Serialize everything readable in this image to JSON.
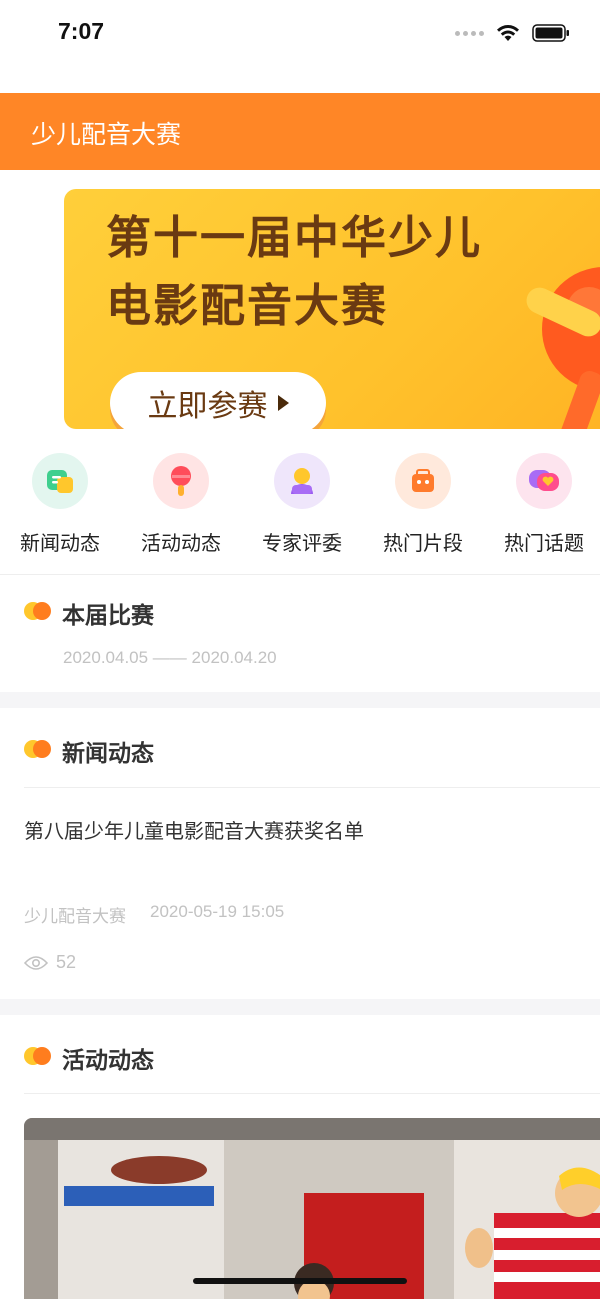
{
  "status": {
    "time": "7:07"
  },
  "header": {
    "title": "少儿配音大赛"
  },
  "banner": {
    "line1": "第十一届中华少儿",
    "line2": "电影配音大赛",
    "button_label": "立即参赛"
  },
  "nav": {
    "items": [
      {
        "label": "新闻动态",
        "icon": "news-chat-icon",
        "bg": "#e3f6ef"
      },
      {
        "label": "活动动态",
        "icon": "microphone-icon",
        "bg": "#ffe4e4"
      },
      {
        "label": "专家评委",
        "icon": "judge-person-icon",
        "bg": "#efe6fb"
      },
      {
        "label": "热门片段",
        "icon": "clapper-bag-icon",
        "bg": "#ffe9dc"
      },
      {
        "label": "热门话题",
        "icon": "topic-heart-chat-icon",
        "bg": "#fde4ee"
      }
    ]
  },
  "current_competition": {
    "title": "本届比赛",
    "date_range": "2020.04.05 —— 2020.04.20"
  },
  "news": {
    "title": "新闻动态",
    "item": {
      "headline": "第八届少年儿童电影配音大赛获奖名单",
      "source": "少儿配音大赛",
      "timestamp": "2020-05-19 15:05",
      "views": "52"
    }
  },
  "activity": {
    "title": "活动动态"
  },
  "colors": {
    "brand": "#ff8626",
    "banner": "#ffc22c"
  }
}
